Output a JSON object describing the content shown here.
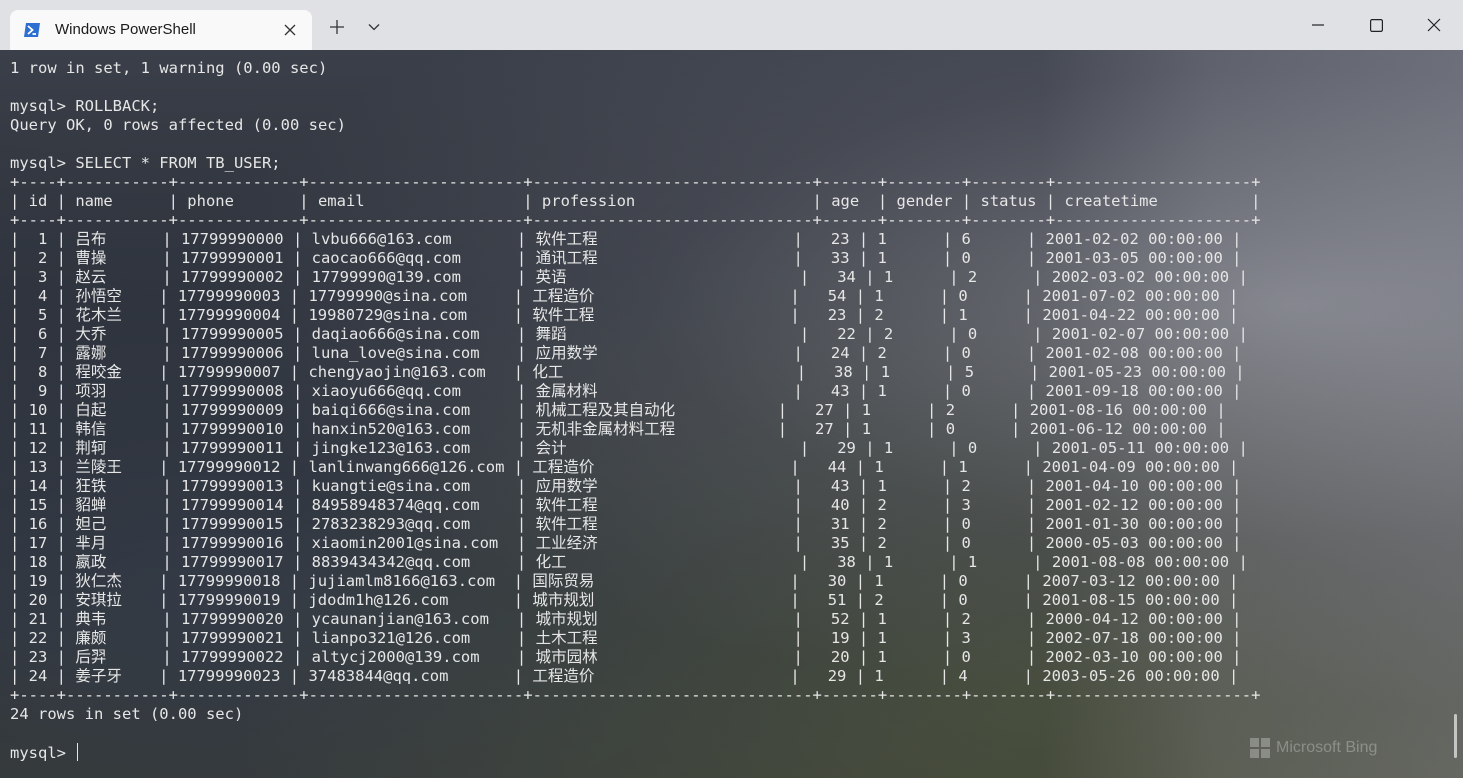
{
  "window": {
    "tab_title": "Windows PowerShell",
    "icon": "powershell-icon",
    "controls": [
      "minimize-icon",
      "maximize-icon",
      "close-icon"
    ]
  },
  "terminal": {
    "lines": [
      "1 row in set, 1 warning (0.00 sec)",
      "",
      "mysql> ROLLBACK;",
      "Query OK, 0 rows affected (0.00 sec)",
      "",
      "mysql> SELECT * FROM TB_USER;",
      "+----+-----------+-------------+-----------------------+------------------------------+------+--------+--------+---------------------+",
      "| id | name      | phone       | email                 | profession                   | age  | gender | status | createtime          |",
      "+----+-----------+-------------+-----------------------+------------------------------+------+--------+--------+---------------------+",
      "|  1 | 吕布      | 17799990000 | lvbu666@163.com       | 软件工程                     |   23 | 1      | 6      | 2001-02-02 00:00:00 |",
      "|  2 | 曹操      | 17799990001 | caocao666@qq.com      | 通讯工程                     |   33 | 1      | 0      | 2001-03-05 00:00:00 |",
      "|  3 | 赵云      | 17799990002 | 17799990@139.com      | 英语                         |   34 | 1      | 2      | 2002-03-02 00:00:00 |",
      "|  4 | 孙悟空    | 17799990003 | 17799990@sina.com     | 工程造价                     |   54 | 1      | 0      | 2001-07-02 00:00:00 |",
      "|  5 | 花木兰    | 17799990004 | 19980729@sina.com     | 软件工程                     |   23 | 2      | 1      | 2001-04-22 00:00:00 |",
      "|  6 | 大乔      | 17799990005 | daqiao666@sina.com    | 舞蹈                         |   22 | 2      | 0      | 2001-02-07 00:00:00 |",
      "|  7 | 露娜      | 17799990006 | luna_love@sina.com    | 应用数学                     |   24 | 2      | 0      | 2001-02-08 00:00:00 |",
      "|  8 | 程咬金    | 17799990007 | chengyaojin@163.com   | 化工                         |   38 | 1      | 5      | 2001-05-23 00:00:00 |",
      "|  9 | 项羽      | 17799990008 | xiaoyu666@qq.com      | 金属材料                     |   43 | 1      | 0      | 2001-09-18 00:00:00 |",
      "| 10 | 白起      | 17799990009 | baiqi666@sina.com     | 机械工程及其自动化           |   27 | 1      | 2      | 2001-08-16 00:00:00 |",
      "| 11 | 韩信      | 17799990010 | hanxin520@163.com     | 无机非金属材料工程           |   27 | 1      | 0      | 2001-06-12 00:00:00 |",
      "| 12 | 荆轲      | 17799990011 | jingke123@163.com     | 会计                         |   29 | 1      | 0      | 2001-05-11 00:00:00 |",
      "| 13 | 兰陵王    | 17799990012 | lanlinwang666@126.com | 工程造价                     |   44 | 1      | 1      | 2001-04-09 00:00:00 |",
      "| 14 | 狂铁      | 17799990013 | kuangtie@sina.com     | 应用数学                     |   43 | 1      | 2      | 2001-04-10 00:00:00 |",
      "| 15 | 貂蝉      | 17799990014 | 84958948374@qq.com    | 软件工程                     |   40 | 2      | 3      | 2001-02-12 00:00:00 |",
      "| 16 | 妲己      | 17799990015 | 2783238293@qq.com     | 软件工程                     |   31 | 2      | 0      | 2001-01-30 00:00:00 |",
      "| 17 | 芈月      | 17799990016 | xiaomin2001@sina.com  | 工业经济                     |   35 | 2      | 0      | 2000-05-03 00:00:00 |",
      "| 18 | 嬴政      | 17799990017 | 8839434342@qq.com     | 化工                         |   38 | 1      | 1      | 2001-08-08 00:00:00 |",
      "| 19 | 狄仁杰    | 17799990018 | jujiamlm8166@163.com  | 国际贸易                     |   30 | 1      | 0      | 2007-03-12 00:00:00 |",
      "| 20 | 安琪拉    | 17799990019 | jdodm1h@126.com       | 城市规划                     |   51 | 2      | 0      | 2001-08-15 00:00:00 |",
      "| 21 | 典韦      | 17799990020 | ycaunanjian@163.com   | 城市规划                     |   52 | 1      | 2      | 2000-04-12 00:00:00 |",
      "| 22 | 廉颇      | 17799990021 | lianpo321@126.com     | 土木工程                     |   19 | 1      | 3      | 2002-07-18 00:00:00 |",
      "| 23 | 后羿      | 17799990022 | altycj2000@139.com    | 城市园林                     |   20 | 1      | 0      | 2002-03-10 00:00:00 |",
      "| 24 | 姜子牙    | 17799990023 | 37483844@qq.com       | 工程造价                     |   29 | 1      | 4      | 2003-05-26 00:00:00 |",
      "+----+-----------+-------------+-----------------------+------------------------------+------+--------+--------+---------------------+",
      "24 rows in set (0.00 sec)",
      ""
    ],
    "prompt": "mysql> "
  },
  "watermark": {
    "text": "Microsoft Bing",
    "icon": "bing-logo-icon"
  },
  "colors": {
    "titlebar": "#dfe1e5",
    "tab": "#f9f9f9",
    "terminal_text": "#e6e6e6"
  }
}
